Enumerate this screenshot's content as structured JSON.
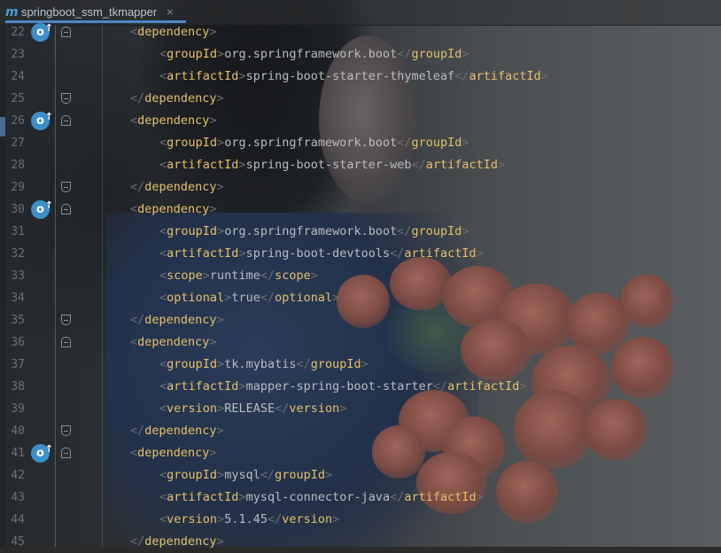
{
  "tab": {
    "icon": "maven-m-icon",
    "icon_glyph": "m",
    "title": "springboot_ssm_tkmapper",
    "close": "×"
  },
  "lines": [
    {
      "num": "22",
      "indent": 1,
      "kind": "open",
      "tag": "dependency",
      "fold": "close",
      "marker": true
    },
    {
      "num": "23",
      "indent": 2,
      "kind": "elem",
      "tag": "groupId",
      "text": "org.springframework.boot"
    },
    {
      "num": "24",
      "indent": 2,
      "kind": "elem",
      "tag": "artifactId",
      "text": "spring-boot-starter-thymeleaf"
    },
    {
      "num": "25",
      "indent": 1,
      "kind": "close",
      "tag": "dependency",
      "fold": "open"
    },
    {
      "num": "26",
      "indent": 1,
      "kind": "open",
      "tag": "dependency",
      "fold": "close",
      "marker": true
    },
    {
      "num": "27",
      "indent": 2,
      "kind": "elem",
      "tag": "groupId",
      "text": "org.springframework.boot"
    },
    {
      "num": "28",
      "indent": 2,
      "kind": "elem",
      "tag": "artifactId",
      "text": "spring-boot-starter-web"
    },
    {
      "num": "29",
      "indent": 1,
      "kind": "close",
      "tag": "dependency",
      "fold": "open"
    },
    {
      "num": "30",
      "indent": 1,
      "kind": "open",
      "tag": "dependency",
      "fold": "close",
      "marker": true
    },
    {
      "num": "31",
      "indent": 2,
      "kind": "elem",
      "tag": "groupId",
      "text": "org.springframework.boot"
    },
    {
      "num": "32",
      "indent": 2,
      "kind": "elem",
      "tag": "artifactId",
      "text": "spring-boot-devtools"
    },
    {
      "num": "33",
      "indent": 2,
      "kind": "elem",
      "tag": "scope",
      "text": "runtime"
    },
    {
      "num": "34",
      "indent": 2,
      "kind": "elem",
      "tag": "optional",
      "text": "true"
    },
    {
      "num": "35",
      "indent": 1,
      "kind": "close",
      "tag": "dependency",
      "fold": "open"
    },
    {
      "num": "36",
      "indent": 1,
      "kind": "open",
      "tag": "dependency",
      "fold": "close"
    },
    {
      "num": "37",
      "indent": 2,
      "kind": "elem",
      "tag": "groupId",
      "text": "tk.mybatis"
    },
    {
      "num": "38",
      "indent": 2,
      "kind": "elem",
      "tag": "artifactId",
      "text": "mapper-spring-boot-starter"
    },
    {
      "num": "39",
      "indent": 2,
      "kind": "elem",
      "tag": "version",
      "text": "RELEASE"
    },
    {
      "num": "40",
      "indent": 1,
      "kind": "close",
      "tag": "dependency",
      "fold": "open"
    },
    {
      "num": "41",
      "indent": 1,
      "kind": "open",
      "tag": "dependency",
      "fold": "close",
      "marker": true
    },
    {
      "num": "42",
      "indent": 2,
      "kind": "elem",
      "tag": "groupId",
      "text": "mysql"
    },
    {
      "num": "43",
      "indent": 2,
      "kind": "elem",
      "tag": "artifactId",
      "text": "mysql-connector-java"
    },
    {
      "num": "44",
      "indent": 2,
      "kind": "elem",
      "tag": "version",
      "text": "5.1.45"
    },
    {
      "num": "45",
      "indent": 1,
      "kind": "close",
      "tag": "dependency"
    }
  ],
  "icons": {
    "marker": "maven-override-icon",
    "fold_open": "fold-end-icon",
    "fold_close": "fold-start-icon"
  },
  "colors": {
    "tag": "#e8bf6a",
    "bracket": "#6b6f74",
    "text": "#b9bcbf",
    "marker": "#3d8fc9",
    "tab_underline": "#4a88c7"
  }
}
